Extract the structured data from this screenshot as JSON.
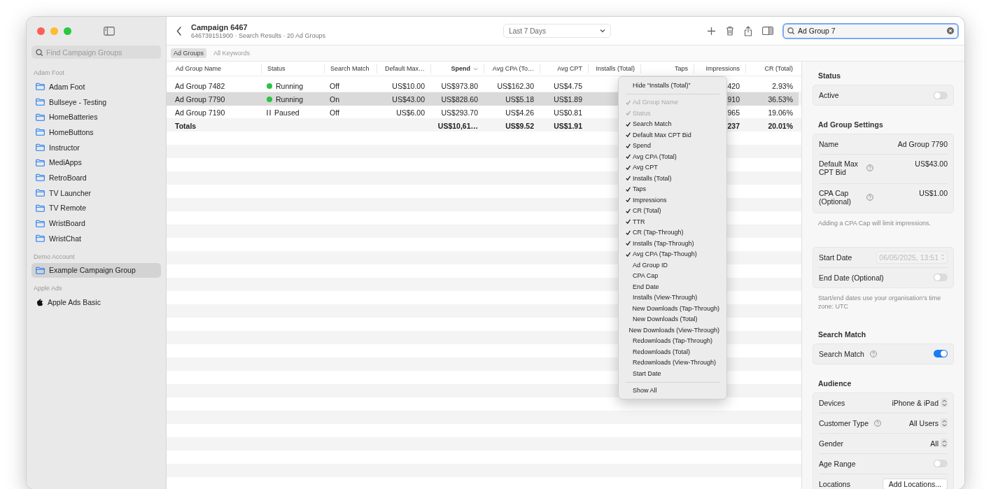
{
  "sidebar": {
    "search": {
      "placeholder": "Find Campaign Groups"
    },
    "sections": [
      {
        "title": "Adam Foot",
        "items": [
          {
            "label": "Adam Foot",
            "kind": "folder",
            "selected": false
          },
          {
            "label": "Bullseye - Testing",
            "kind": "folder",
            "selected": false
          },
          {
            "label": "HomeBatteries",
            "kind": "folder",
            "selected": false
          },
          {
            "label": "HomeButtons",
            "kind": "folder",
            "selected": false
          },
          {
            "label": "Instructor",
            "kind": "folder",
            "selected": false
          },
          {
            "label": "MediApps",
            "kind": "folder",
            "selected": false
          },
          {
            "label": "RetroBoard",
            "kind": "folder",
            "selected": false
          },
          {
            "label": "TV Launcher",
            "kind": "folder",
            "selected": false
          },
          {
            "label": "TV Remote",
            "kind": "folder",
            "selected": false
          },
          {
            "label": "WristBoard",
            "kind": "folder",
            "selected": false
          },
          {
            "label": "WristChat",
            "kind": "folder",
            "selected": false
          }
        ]
      },
      {
        "title": "Demo Account",
        "items": [
          {
            "label": "Example Campaign Group",
            "kind": "folder",
            "selected": true
          }
        ]
      },
      {
        "title": "Apple Ads",
        "items": [
          {
            "label": "Apple Ads Basic",
            "kind": "apple",
            "selected": false
          }
        ]
      }
    ]
  },
  "toolbar": {
    "title": "Campaign 6467",
    "subtitle": "646739151900 · Search Results · 20 Ad Groups",
    "date_range": "Last 7 Days",
    "search": {
      "value": "Ad Group 7"
    }
  },
  "tabs": [
    {
      "label": "Ad Groups",
      "selected": true
    },
    {
      "label": "All Keywords",
      "selected": false
    }
  ],
  "table": {
    "columns": [
      {
        "label": "Ad Group Name",
        "sorted": false
      },
      {
        "label": "Status",
        "sorted": false
      },
      {
        "label": "Search Match",
        "sorted": false
      },
      {
        "label": "Default Max…",
        "sorted": false
      },
      {
        "label": "Spend",
        "sorted": true
      },
      {
        "label": "Avg CPA (To…",
        "sorted": false
      },
      {
        "label": "Avg CPT",
        "sorted": false
      },
      {
        "label": "Installs (Total)",
        "sorted": false
      },
      {
        "label": "Taps",
        "sorted": false
      },
      {
        "label": "Impressions",
        "sorted": false
      },
      {
        "label": "CR (Total)",
        "sorted": false
      }
    ],
    "rows": [
      {
        "selected": false,
        "name": "Ad Group 7482",
        "status": {
          "kind": "running",
          "label": "Running"
        },
        "search_match": "Off",
        "default_max": "US$10.00",
        "spend": "US$973.80",
        "avg_cpa": "US$162.30",
        "avg_cpt": "US$4.75",
        "impressions": "420",
        "cr": "2.93%"
      },
      {
        "selected": true,
        "name": "Ad Group 7790",
        "status": {
          "kind": "running",
          "label": "Running"
        },
        "search_match": "On",
        "default_max": "US$43.00",
        "spend": "US$828.60",
        "avg_cpa": "US$5.18",
        "avg_cpt": "US$1.89",
        "impressions": "910",
        "cr": "36.53%"
      },
      {
        "selected": false,
        "name": "Ad Group 7190",
        "status": {
          "kind": "paused",
          "label": "Paused"
        },
        "search_match": "Off",
        "default_max": "US$6.00",
        "spend": "US$293.70",
        "avg_cpa": "US$4.26",
        "avg_cpt": "US$0.81",
        "impressions": "965",
        "cr": "19.06%"
      }
    ],
    "totals": {
      "label": "Totals",
      "spend": "US$10,61…",
      "avg_cpa": "US$9.52",
      "avg_cpt": "US$1.91",
      "impressions": "237",
      "cr": "20.01%"
    }
  },
  "context_menu": {
    "hide_item": "Hide “Installs (Total)”",
    "items": [
      {
        "label": "Ad Group Name",
        "checked": true,
        "disabled": true
      },
      {
        "label": "Status",
        "checked": true,
        "disabled": true
      },
      {
        "label": "Search Match",
        "checked": true,
        "disabled": false
      },
      {
        "label": "Default Max CPT Bid",
        "checked": true,
        "disabled": false
      },
      {
        "label": "Spend",
        "checked": true,
        "disabled": false
      },
      {
        "label": "Avg CPA (Total)",
        "checked": true,
        "disabled": false
      },
      {
        "label": "Avg CPT",
        "checked": true,
        "disabled": false
      },
      {
        "label": "Installs (Total)",
        "checked": true,
        "disabled": false
      },
      {
        "label": "Taps",
        "checked": true,
        "disabled": false
      },
      {
        "label": "Impressions",
        "checked": true,
        "disabled": false
      },
      {
        "label": "CR (Total)",
        "checked": true,
        "disabled": false
      },
      {
        "label": "TTR",
        "checked": true,
        "disabled": false
      },
      {
        "label": "CR (Tap-Through)",
        "checked": true,
        "disabled": false
      },
      {
        "label": "Installs (Tap-Through)",
        "checked": true,
        "disabled": false
      },
      {
        "label": "Avg CPA (Tap-Though)",
        "checked": true,
        "disabled": false
      },
      {
        "label": "Ad Group ID",
        "checked": false,
        "disabled": false
      },
      {
        "label": "CPA Cap",
        "checked": false,
        "disabled": false
      },
      {
        "label": "End Date",
        "checked": false,
        "disabled": false
      },
      {
        "label": "Installs (View-Through)",
        "checked": false,
        "disabled": false
      },
      {
        "label": "New Downloads (Tap-Through)",
        "checked": false,
        "disabled": false
      },
      {
        "label": "New Downloads (Total)",
        "checked": false,
        "disabled": false
      },
      {
        "label": "New Downloads (View-Through)",
        "checked": false,
        "disabled": false
      },
      {
        "label": "Redownloads (Tap-Through)",
        "checked": false,
        "disabled": false
      },
      {
        "label": "Redownloads (Total)",
        "checked": false,
        "disabled": false
      },
      {
        "label": "Redownloads (View-Through)",
        "checked": false,
        "disabled": false
      },
      {
        "label": "Start Date",
        "checked": false,
        "disabled": false
      }
    ],
    "show_all": "Show All"
  },
  "inspector": {
    "sections": [
      {
        "title": "Status",
        "rows": [
          {
            "kind": "toggle",
            "label": "Active",
            "on": false
          }
        ]
      },
      {
        "title": "Ad Group Settings",
        "rows": [
          {
            "kind": "value",
            "label": "Name",
            "value": "Ad Group 7790"
          },
          {
            "kind": "value",
            "label": "Default Max CPT Bid",
            "help": true,
            "value": "US$43.00"
          },
          {
            "kind": "value",
            "label": "CPA Cap (Optional)",
            "help": true,
            "value": "US$1.00"
          }
        ],
        "note": "Adding a CPA Cap will limit impressions."
      },
      {
        "rows": [
          {
            "kind": "date",
            "label": "Start Date",
            "value": "06/05/2025, 13:51",
            "disabled": true
          },
          {
            "kind": "toggle",
            "label": "End Date (Optional)",
            "on": false
          }
        ],
        "note": "Start/end dates use your organisation's time zone: UTC"
      },
      {
        "title": "Search Match",
        "rows": [
          {
            "kind": "toggle",
            "label": "Search Match",
            "help": true,
            "on": true
          }
        ]
      },
      {
        "title": "Audience",
        "rows": [
          {
            "kind": "popup",
            "label": "Devices",
            "value": "iPhone & iPad"
          },
          {
            "kind": "popup",
            "label": "Customer Type",
            "help": true,
            "value": "All Users"
          },
          {
            "kind": "popup",
            "label": "Gender",
            "value": "All"
          },
          {
            "kind": "toggle",
            "label": "Age Range",
            "on": false
          },
          {
            "kind": "button",
            "label": "Locations",
            "value": "Add Locations..."
          }
        ]
      }
    ]
  }
}
